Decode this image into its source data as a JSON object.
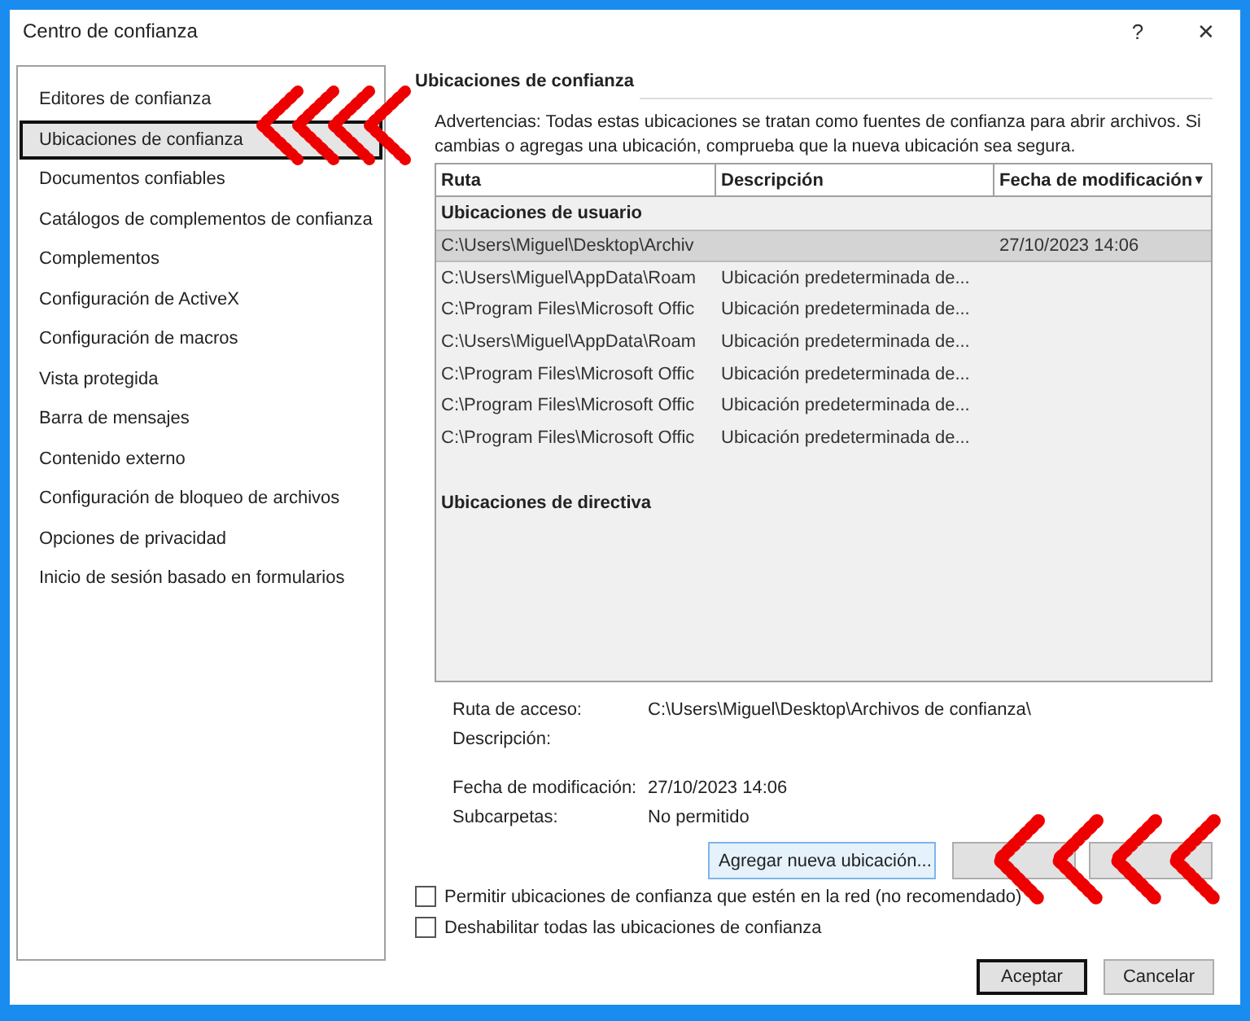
{
  "window": {
    "title": "Centro de confianza",
    "help": "?",
    "close": "✕"
  },
  "sidebar": {
    "items": [
      {
        "label": "Editores de confianza",
        "selected": false
      },
      {
        "label": "Ubicaciones de confianza",
        "selected": true
      },
      {
        "label": "Documentos confiables",
        "selected": false
      },
      {
        "label": "Catálogos de complementos de confianza",
        "selected": false
      },
      {
        "label": "Complementos",
        "selected": false
      },
      {
        "label": "Configuración de ActiveX",
        "selected": false
      },
      {
        "label": "Configuración de macros",
        "selected": false
      },
      {
        "label": "Vista protegida",
        "selected": false
      },
      {
        "label": "Barra de mensajes",
        "selected": false
      },
      {
        "label": "Contenido externo",
        "selected": false
      },
      {
        "label": "Configuración de bloqueo de archivos",
        "selected": false
      },
      {
        "label": "Opciones de privacidad",
        "selected": false
      },
      {
        "label": "Inicio de sesión basado en formularios",
        "selected": false
      }
    ]
  },
  "section_title": "Ubicaciones de confianza",
  "warning": "Advertencias: Todas estas ubicaciones se tratan como fuentes de confianza para abrir archivos. Si cambias o agregas una ubicación, comprueba que la nueva ubicación sea segura.",
  "table": {
    "columns": [
      "Ruta",
      "Descripción",
      "Fecha de modificación"
    ],
    "sort_indicator": "▼",
    "rows": [
      {
        "kind": "group",
        "label": "Ubicaciones de usuario"
      },
      {
        "kind": "row",
        "cells": [
          "C:\\Users\\Miguel\\Desktop\\Archiv",
          null,
          "27/10/2023 14:06"
        ],
        "selected": true
      },
      {
        "kind": "row",
        "cells": [
          "C:\\Users\\Miguel\\AppData\\Roam",
          "Ubicación predeterminada de...",
          null
        ],
        "selected": false
      },
      {
        "kind": "row",
        "cells": [
          "C:\\Program Files\\Microsoft Offic",
          "Ubicación predeterminada de...",
          null
        ],
        "selected": false
      },
      {
        "kind": "row",
        "cells": [
          "C:\\Users\\Miguel\\AppData\\Roam",
          "Ubicación predeterminada de...",
          null
        ],
        "selected": false
      },
      {
        "kind": "row",
        "cells": [
          "C:\\Program Files\\Microsoft Offic",
          "Ubicación predeterminada de...",
          null
        ],
        "selected": false
      },
      {
        "kind": "row",
        "cells": [
          "C:\\Program Files\\Microsoft Offic",
          "Ubicación predeterminada de...",
          null
        ],
        "selected": false
      },
      {
        "kind": "row",
        "cells": [
          "C:\\Program Files\\Microsoft Offic",
          "Ubicación predeterminada de...",
          null
        ],
        "selected": false
      },
      {
        "kind": "spacer"
      },
      {
        "kind": "group",
        "label": "Ubicaciones de directiva"
      }
    ]
  },
  "details": [
    {
      "label": "Ruta de acceso:",
      "value": "C:\\Users\\Miguel\\Desktop\\Archivos de confianza\\"
    },
    {
      "label": "Descripción:"
    },
    {
      "kind": "gap"
    },
    {
      "label": "Fecha de modificación:",
      "value": "27/10/2023 14:06"
    },
    {
      "label": "Subcarpetas:",
      "value": "No permitido"
    }
  ],
  "actions": [
    {
      "label": "Agregar nueva ubicación...",
      "kind": "button"
    },
    {
      "kind": "covered"
    },
    {
      "kind": "covered"
    }
  ],
  "checkboxes": [
    {
      "label": "Permitir ubicaciones de confianza que estén en la red (no recomendado)",
      "checked": false
    },
    {
      "label": "Deshabilitar todas las ubicaciones de confianza",
      "checked": false
    }
  ],
  "buttons": [
    {
      "label": "Aceptar",
      "default": true
    },
    {
      "label": "Cancelar",
      "default": false
    }
  ]
}
